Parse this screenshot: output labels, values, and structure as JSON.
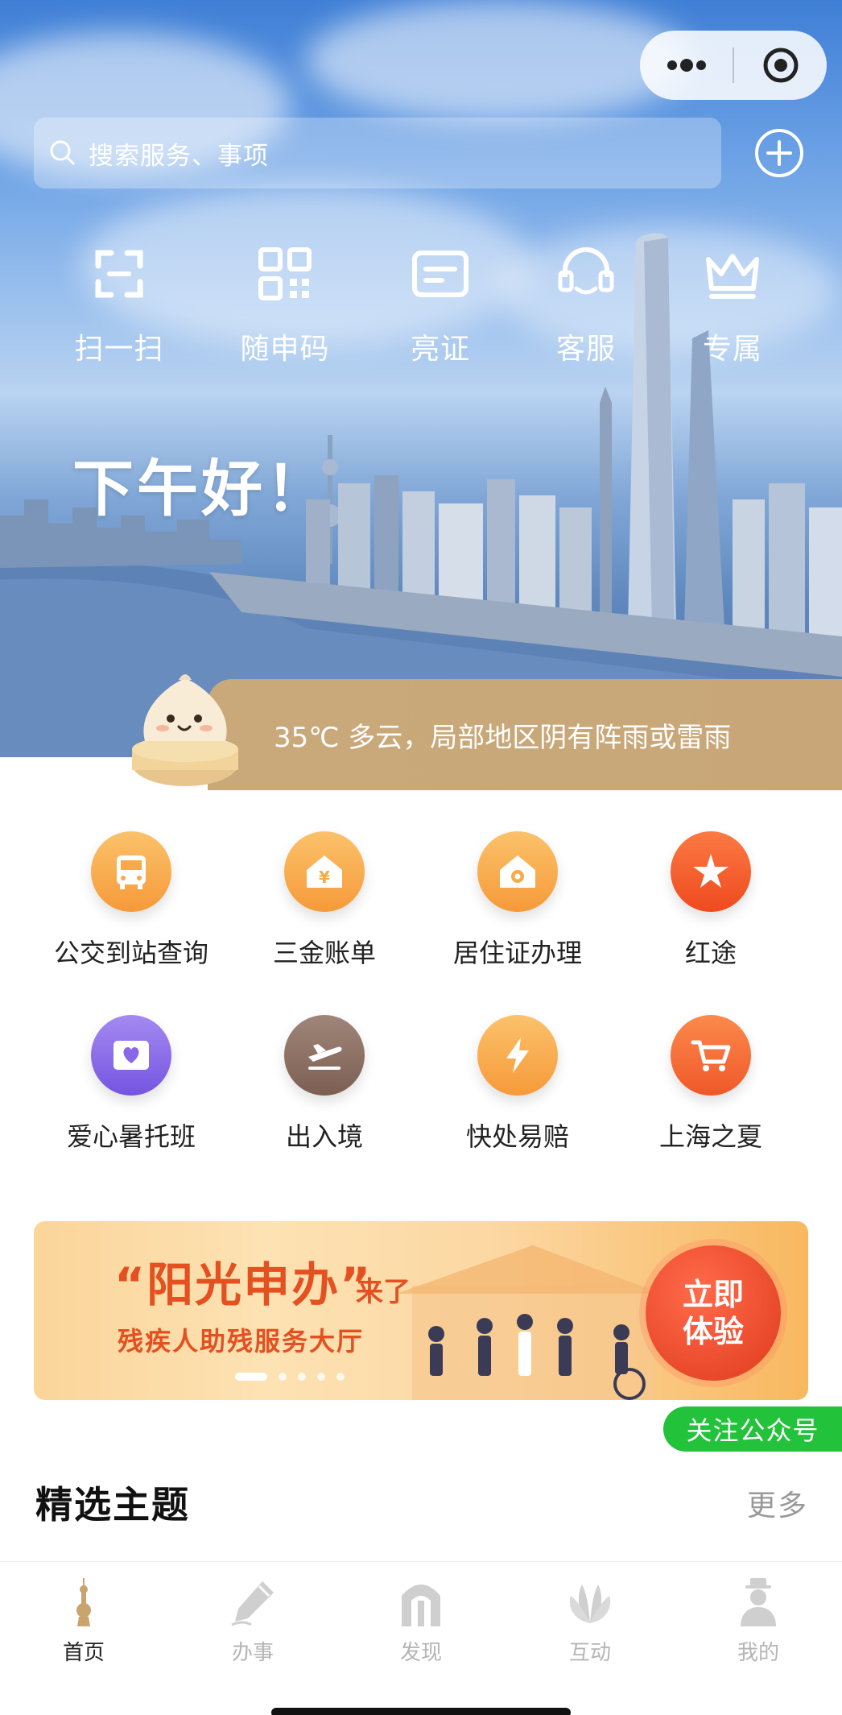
{
  "capsule": {
    "more_icon": "more-dots-icon",
    "close_icon": "target-close-icon"
  },
  "search": {
    "placeholder": "搜索服务、事项"
  },
  "quick_actions": [
    {
      "label": "扫一扫",
      "icon": "scan-icon"
    },
    {
      "label": "随申码",
      "icon": "qr-code-icon"
    },
    {
      "label": "亮证",
      "icon": "id-card-icon"
    },
    {
      "label": "客服",
      "icon": "headset-icon"
    },
    {
      "label": "专属",
      "icon": "crown-icon"
    }
  ],
  "greeting": "下午好！",
  "weather": {
    "text": "35℃ 多云，局部地区阴有阵雨或雷雨"
  },
  "services": [
    {
      "label": "公交到站查询",
      "icon": "bus-icon",
      "color": "#f9a94a"
    },
    {
      "label": "三金账单",
      "icon": "house-yen-icon",
      "color": "#f9a94a"
    },
    {
      "label": "居住证办理",
      "icon": "home-badge-icon",
      "color": "#f9a94a"
    },
    {
      "label": "红途",
      "icon": "red-star-icon",
      "color": "#f5552c"
    },
    {
      "label": "爱心暑托班",
      "icon": "heart-card-icon",
      "color": "#8a66e8"
    },
    {
      "label": "出入境",
      "icon": "plane-icon",
      "color": "#8c6d5e"
    },
    {
      "label": "快处易赔",
      "icon": "lightning-icon",
      "color": "#f9a94a"
    },
    {
      "label": "上海之夏",
      "icon": "cart-icon",
      "color": "#f5703a"
    }
  ],
  "banner": {
    "title": "“阳光申办”",
    "title_suffix": "来了",
    "subtitle": "残疾人助残服务大厅",
    "cta_line1": "立即",
    "cta_line2": "体验",
    "slides": 5,
    "active_slide": 0
  },
  "follow_label": "关注公众号",
  "section": {
    "title": "精选主题",
    "more": "更多"
  },
  "tabs": [
    {
      "label": "首页",
      "icon": "pagoda-icon",
      "active": true
    },
    {
      "label": "办事",
      "icon": "pen-icon",
      "active": false
    },
    {
      "label": "发现",
      "icon": "arch-icon",
      "active": false
    },
    {
      "label": "互动",
      "icon": "magnolia-icon",
      "active": false
    },
    {
      "label": "我的",
      "icon": "user-icon",
      "active": false
    }
  ]
}
